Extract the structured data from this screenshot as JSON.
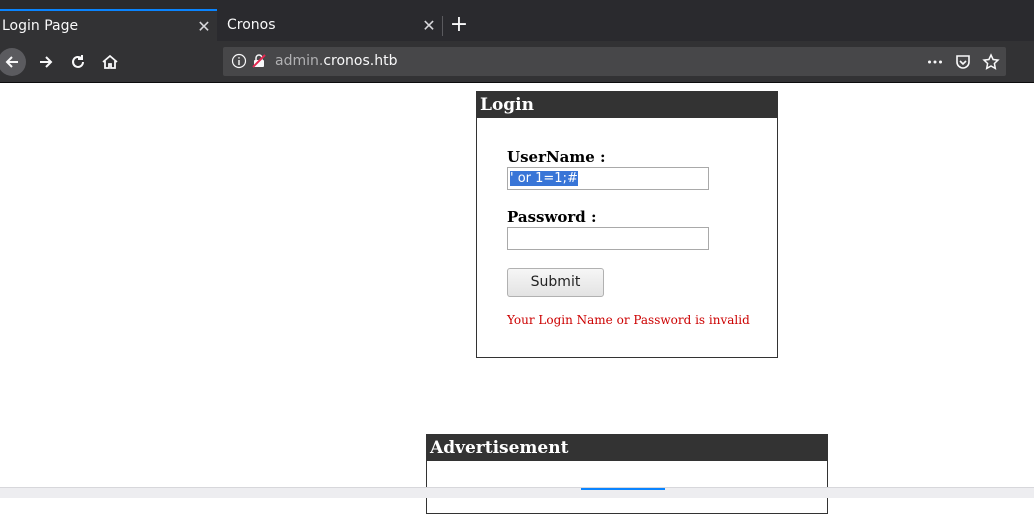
{
  "browser": {
    "tabs": [
      {
        "title": "Login Page",
        "active": true
      },
      {
        "title": "Cronos",
        "active": false
      }
    ],
    "url": {
      "prefix": "admin.",
      "domain": "cronos.htb"
    }
  },
  "login": {
    "title": "Login",
    "username_label": "UserName :",
    "username_value": "' or 1=1;#",
    "password_label": "Password :",
    "password_value": "",
    "submit_label": "Submit",
    "error_message": "Your Login Name or Password is invalid"
  },
  "advertisement": {
    "title": "Advertisement"
  },
  "colors": {
    "tab_accent": "#0a84ff",
    "box_header": "#333333",
    "error": "#cc0000",
    "selection": "#3875d7"
  }
}
